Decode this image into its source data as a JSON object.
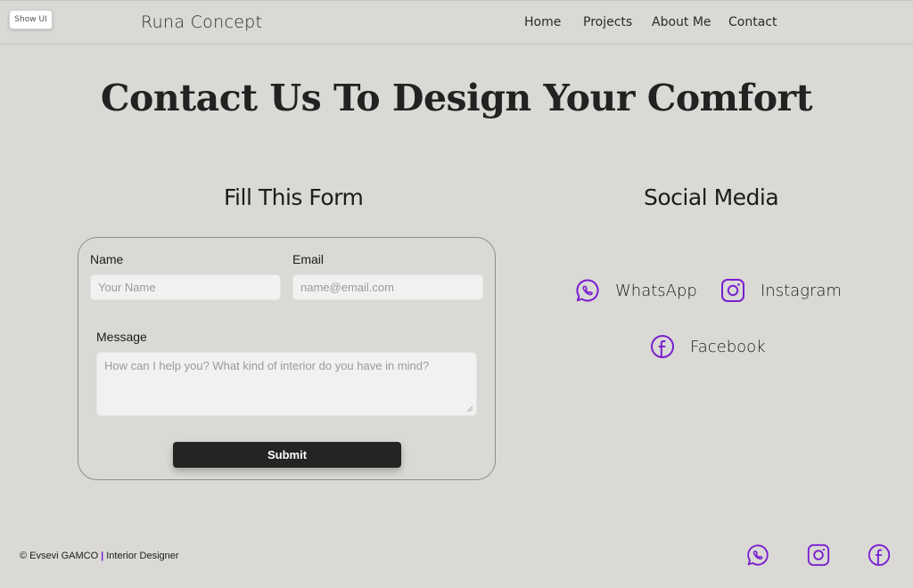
{
  "header": {
    "show_ui": "Show UI",
    "brand": "Runa Concept",
    "nav": [
      "Home",
      "Projects",
      "About Me",
      "Contact"
    ]
  },
  "page_title": "Contact Us To Design Your Comfort",
  "form": {
    "title": "Fill This Form",
    "name_label": "Name",
    "name_placeholder": "Your Name",
    "email_label": "Email",
    "email_placeholder": "name@email.com",
    "message_label": "Message",
    "message_placeholder": "How can I help you? What kind of interior do you have in mind?",
    "submit": "Submit"
  },
  "social": {
    "title": "Social Media",
    "items": [
      {
        "label": "WhatsApp",
        "icon": "whatsapp-icon"
      },
      {
        "label": "Instagram",
        "icon": "instagram-icon"
      },
      {
        "label": "Facebook",
        "icon": "facebook-icon"
      }
    ]
  },
  "footer": {
    "copyright": "© Evsevi GAMCO",
    "separator": "|",
    "role": "Interior Designer"
  },
  "colors": {
    "background": "#dad9d5",
    "accent": "#7a1fd0",
    "button": "#242424"
  }
}
